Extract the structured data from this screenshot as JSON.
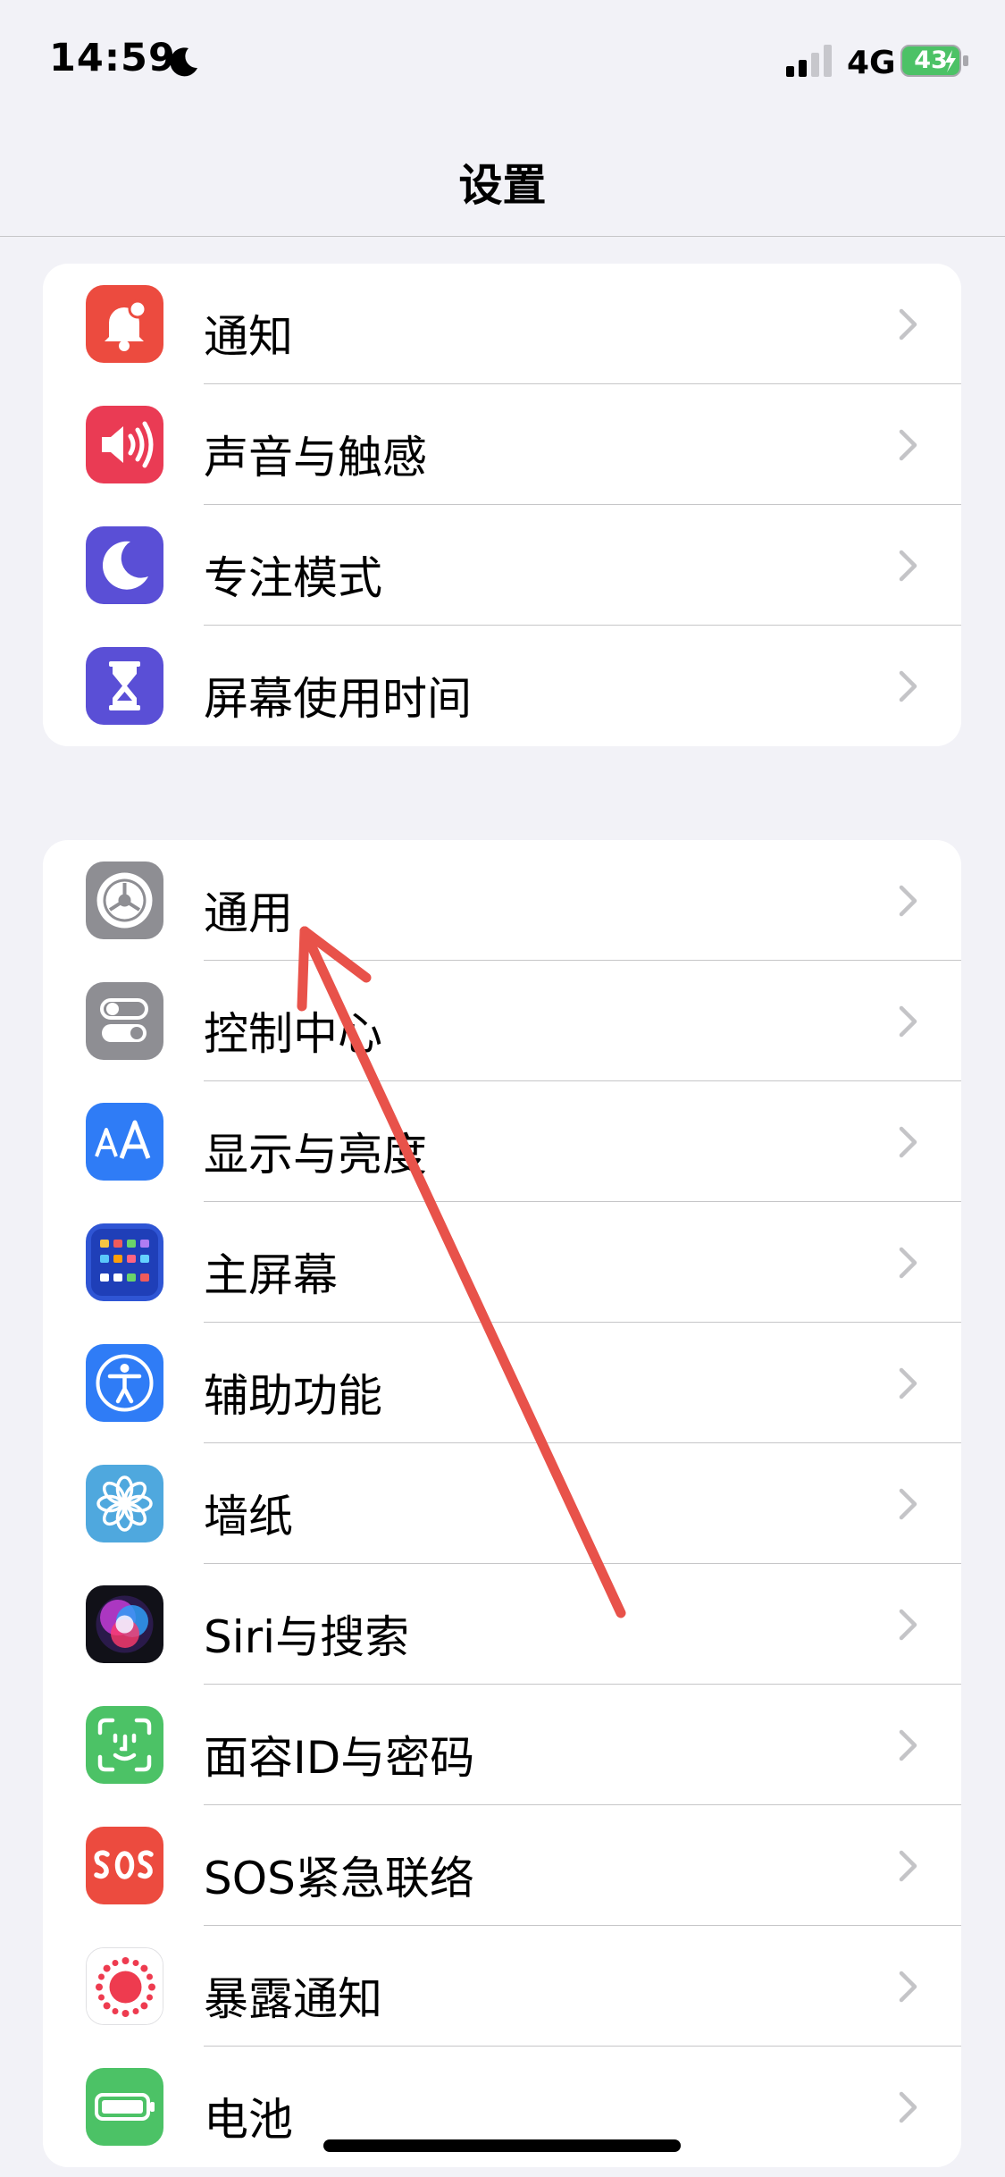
{
  "status_bar": {
    "time": "14:59",
    "network": "4G",
    "battery": "43"
  },
  "header": {
    "title": "设置"
  },
  "groups": [
    {
      "items": [
        {
          "label": "通知",
          "icon": "bell-icon",
          "color": "#ec4b3f"
        },
        {
          "label": "声音与触感",
          "icon": "speaker-icon",
          "color": "#ea3b54"
        },
        {
          "label": "专注模式",
          "icon": "moon-icon",
          "color": "#5a4fd6"
        },
        {
          "label": "屏幕使用时间",
          "icon": "hourglass-icon",
          "color": "#5a4fd6"
        }
      ]
    },
    {
      "items": [
        {
          "label": "通用",
          "icon": "gear-icon",
          "color": "#8e8e93"
        },
        {
          "label": "控制中心",
          "icon": "toggles-icon",
          "color": "#8e8e93"
        },
        {
          "label": "显示与亮度",
          "icon": "text-size-icon",
          "color": "#2f7cf6"
        },
        {
          "label": "主屏幕",
          "icon": "home-grid-icon",
          "color": "#2f55d4"
        },
        {
          "label": "辅助功能",
          "icon": "accessibility-icon",
          "color": "#2f7cf6"
        },
        {
          "label": "墙纸",
          "icon": "flower-icon",
          "color": "#4fa8de"
        },
        {
          "label": "Siri与搜索",
          "icon": "siri-icon",
          "color": "#1c1c2e"
        },
        {
          "label": "面容ID与密码",
          "icon": "face-id-icon",
          "color": "#4cc266"
        },
        {
          "label": "SOS紧急联络",
          "icon": "sos-icon",
          "color": "#ec4b3f"
        },
        {
          "label": "暴露通知",
          "icon": "exposure-icon",
          "color": "#ffffff"
        },
        {
          "label": "电池",
          "icon": "battery-icon",
          "color": "#4cc266"
        }
      ]
    }
  ],
  "annotation": {
    "icon": "red-arrow-icon",
    "color": "#e8524a"
  }
}
